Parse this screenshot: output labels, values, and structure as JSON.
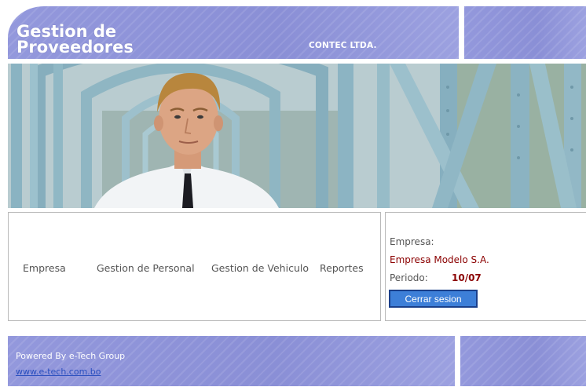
{
  "header": {
    "title": "Gestion de Proveedores",
    "company_name": "CONTEC LTDA."
  },
  "menu": {
    "items": [
      {
        "label": "Empresa"
      },
      {
        "label": "Gestion de Personal"
      },
      {
        "label": "Gestion de Vehiculo"
      },
      {
        "label": "Reportes"
      }
    ]
  },
  "info": {
    "empresa_label": "Empresa:",
    "empresa_value": "Empresa Modelo S.A.",
    "periodo_label": "Periodo:",
    "periodo_value": "10/07",
    "logout_label": "Cerrar sesion"
  },
  "footer": {
    "powered_by": "Powered By e-Tech Group",
    "link": "www.e-tech.com.bo"
  },
  "colors": {
    "band": "#8d92d8",
    "accent_value": "#8b0000",
    "button": "#3d7fd8",
    "link": "#2a4fbf"
  }
}
